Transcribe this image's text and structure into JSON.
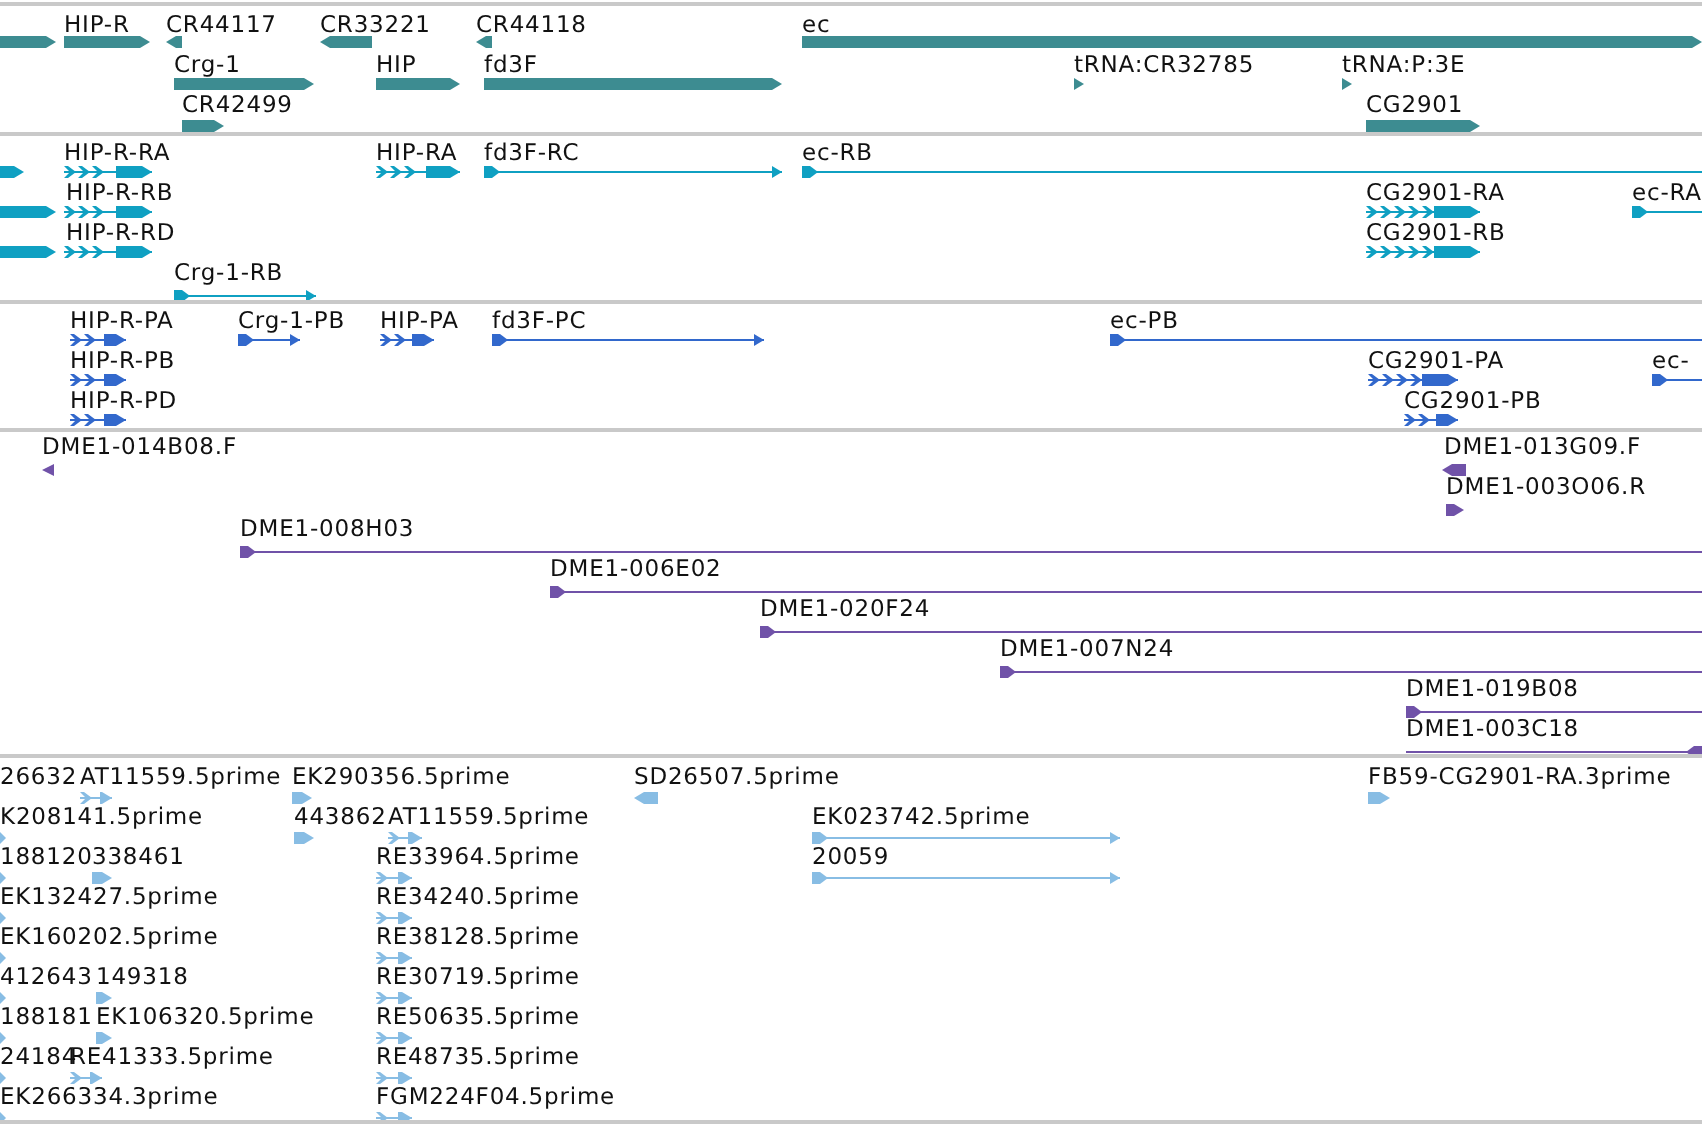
{
  "tracks": [
    {
      "color": "#3d8c91",
      "features": [
        {
          "kind": "block",
          "reverse": false
        },
        {
          "label": "HIP-R",
          "kind": "block",
          "reverse": false
        },
        {
          "label": "CR44117",
          "kind": "block",
          "reverse": true
        },
        {
          "label": "CR33221",
          "kind": "block",
          "reverse": true
        },
        {
          "label": "CR44118",
          "kind": "block",
          "reverse": true
        },
        {
          "label": "ec",
          "kind": "block",
          "reverse": false
        },
        {
          "label": "Crg-1",
          "kind": "block",
          "reverse": false
        },
        {
          "label": "HIP",
          "kind": "block",
          "reverse": false
        },
        {
          "label": "fd3F",
          "kind": "block",
          "reverse": false
        },
        {
          "label": "tRNA:CR32785",
          "kind": "block",
          "reverse": false
        },
        {
          "label": "tRNA:P:3E",
          "kind": "block",
          "reverse": false
        },
        {
          "label": "CR42499",
          "kind": "block",
          "reverse": false
        },
        {
          "label": "CG2901",
          "kind": "block",
          "reverse": false
        }
      ]
    },
    {
      "color": "#0fa0c2",
      "features": [
        {
          "kind": "block",
          "reverse": false
        },
        {
          "label": "HIP-R-RA",
          "kind": "exons",
          "reverse": false
        },
        {
          "label": "HIP-RA",
          "kind": "exons",
          "reverse": false
        },
        {
          "label": "fd3F-RC",
          "kind": "line",
          "reverse": false
        },
        {
          "label": "ec-RB",
          "kind": "line",
          "reverse": false
        },
        {
          "kind": "block",
          "reverse": false
        },
        {
          "label": "HIP-R-RB",
          "kind": "exons",
          "reverse": false
        },
        {
          "label": "CG2901-RA",
          "kind": "exons",
          "reverse": false
        },
        {
          "label": "ec-RA",
          "kind": "line",
          "reverse": false
        },
        {
          "kind": "block",
          "reverse": false
        },
        {
          "label": "HIP-R-RD",
          "kind": "exons",
          "reverse": false
        },
        {
          "label": "CG2901-RB",
          "kind": "exons",
          "reverse": false
        },
        {
          "label": "Crg-1-RB",
          "kind": "line",
          "reverse": false
        }
      ]
    },
    {
      "color": "#3268cc",
      "features": [
        {
          "label": "HIP-R-PA",
          "kind": "exons",
          "reverse": false
        },
        {
          "label": "Crg-1-PB",
          "kind": "line",
          "reverse": false
        },
        {
          "label": "HIP-PA",
          "kind": "exons",
          "reverse": false
        },
        {
          "label": "fd3F-PC",
          "kind": "line",
          "reverse": false
        },
        {
          "label": "ec-PB",
          "kind": "line",
          "reverse": false
        },
        {
          "label": "HIP-R-PB",
          "kind": "exons",
          "reverse": false
        },
        {
          "label": "CG2901-PA",
          "kind": "exons",
          "reverse": false
        },
        {
          "label": "ec-",
          "kind": "line",
          "reverse": false
        },
        {
          "label": "HIP-R-PD",
          "kind": "exons",
          "reverse": false
        },
        {
          "label": "CG2901-PB",
          "kind": "exons",
          "reverse": false
        }
      ]
    },
    {
      "color": "#7052a8",
      "features": [
        {
          "label": "DME1-014B08.F",
          "kind": "block",
          "reverse": true
        },
        {
          "label": "DME1-013G09.F",
          "kind": "block",
          "reverse": true
        },
        {
          "label": "DME1-003O06.R",
          "kind": "block",
          "reverse": false
        },
        {
          "label": "DME1-008H03",
          "kind": "line",
          "reverse": false
        },
        {
          "label": "DME1-006E02",
          "kind": "line",
          "reverse": false
        },
        {
          "label": "DME1-020F24",
          "kind": "line",
          "reverse": false
        },
        {
          "label": "DME1-007N24",
          "kind": "line",
          "reverse": false
        },
        {
          "label": "DME1-019B08",
          "kind": "line",
          "reverse": false
        },
        {
          "label": "DME1-003C18",
          "kind": "line",
          "reverse": true
        }
      ]
    },
    {
      "color": "#88bde4",
      "features": [
        {
          "label": "26632",
          "kind": "none"
        },
        {
          "label": "AT11559.5prime",
          "kind": "exons",
          "reverse": false
        },
        {
          "label": "EK290356.5prime",
          "kind": "block",
          "reverse": false
        },
        {
          "label": "SD26507.5prime",
          "kind": "block",
          "reverse": true
        },
        {
          "label": "FB59-CG2901-RA.3prime",
          "kind": "block",
          "reverse": false
        },
        {
          "label": "K208141.5prime",
          "kind": "block",
          "reverse": false
        },
        {
          "label": "443862",
          "kind": "block",
          "reverse": false
        },
        {
          "label": "AT11559.5prime",
          "kind": "exons",
          "reverse": false
        },
        {
          "label": "EK023742.5prime",
          "kind": "line",
          "reverse": false
        },
        {
          "label": "188120",
          "kind": "block",
          "reverse": false
        },
        {
          "label": "338461",
          "kind": "block",
          "reverse": false
        },
        {
          "label": "RE33964.5prime",
          "kind": "exons",
          "reverse": false
        },
        {
          "label": "20059",
          "kind": "line",
          "reverse": false
        },
        {
          "label": "EK132427.5prime",
          "kind": "block",
          "reverse": false
        },
        {
          "label": "RE34240.5prime",
          "kind": "exons",
          "reverse": false
        },
        {
          "label": "EK160202.5prime",
          "kind": "block",
          "reverse": false
        },
        {
          "label": "RE38128.5prime",
          "kind": "exons",
          "reverse": false
        },
        {
          "label": "412643",
          "kind": "block",
          "reverse": false
        },
        {
          "label": "149318",
          "kind": "block",
          "reverse": false
        },
        {
          "label": "RE30719.5prime",
          "kind": "exons",
          "reverse": false
        },
        {
          "label": "188181",
          "kind": "block",
          "reverse": false
        },
        {
          "label": "EK106320.5prime",
          "kind": "block",
          "reverse": false
        },
        {
          "label": "RE50635.5prime",
          "kind": "exons",
          "reverse": false
        },
        {
          "label": "24184",
          "kind": "block",
          "reverse": false
        },
        {
          "label": "RE41333.5prime",
          "kind": "exons",
          "reverse": false
        },
        {
          "label": "RE48735.5prime",
          "kind": "exons",
          "reverse": false
        },
        {
          "label": "EK266334.3prime",
          "kind": "block",
          "reverse": false
        },
        {
          "label": "FGM224F04.5prime",
          "kind": "exons",
          "reverse": false
        }
      ]
    }
  ]
}
